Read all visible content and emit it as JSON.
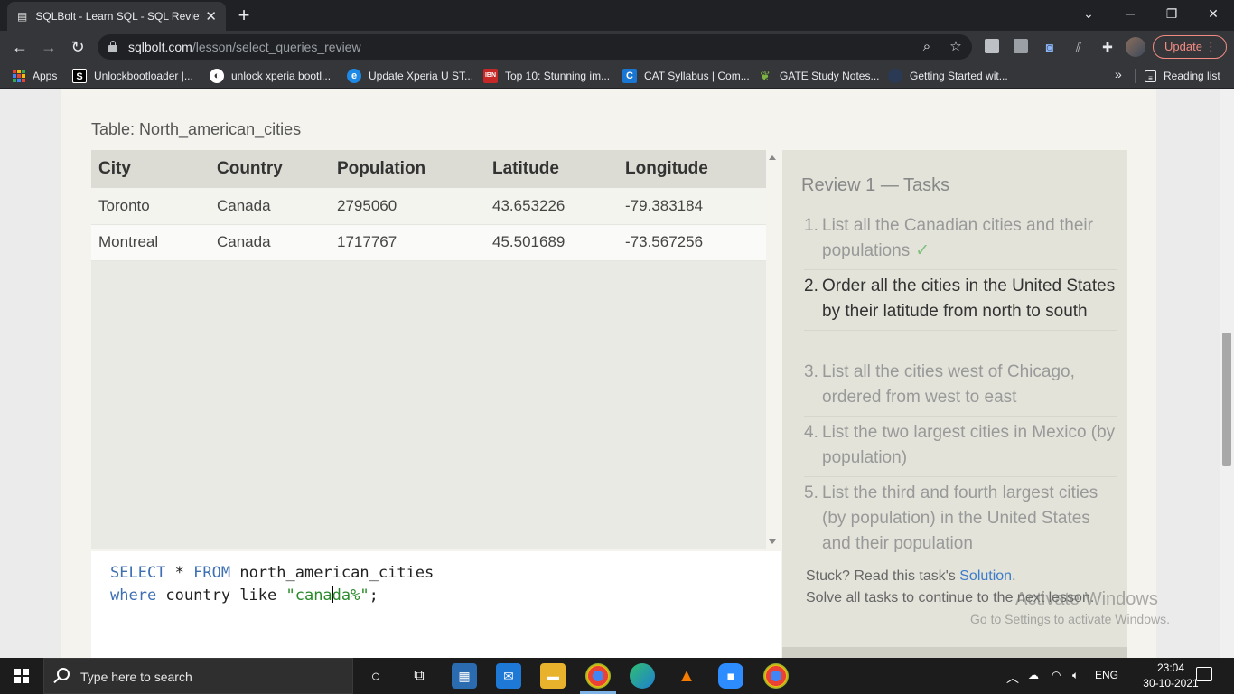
{
  "browser": {
    "tab_title": "SQLBolt - Learn SQL - SQL Review",
    "tab_close": "✕",
    "new_tab": "+",
    "url_host": "sqlbolt.com",
    "url_path": "/lesson/select_queries_review",
    "update_label": "Update",
    "update_more": "⋮"
  },
  "bookmarks": {
    "items": [
      {
        "label": "Apps",
        "icon": "apps-grid"
      },
      {
        "label": "Unlockbootloader |...",
        "icon": "S"
      },
      {
        "label": "unlock xperia bootl...",
        "icon": "globe"
      },
      {
        "label": "Update Xperia U ST...",
        "icon": "e"
      },
      {
        "label": "Top 10: Stunning im...",
        "icon": "IBN"
      },
      {
        "label": "CAT Syllabus | Com...",
        "icon": "C"
      },
      {
        "label": "GATE Study Notes...",
        "icon": "leaf"
      },
      {
        "label": "Getting Started wit...",
        "icon": "blank"
      }
    ],
    "overflow": "»",
    "reading_list": "Reading list"
  },
  "lesson": {
    "table_caption": "Table: North_american_cities",
    "columns": [
      "City",
      "Country",
      "Population",
      "Latitude",
      "Longitude"
    ],
    "rows": [
      [
        "Toronto",
        "Canada",
        "2795060",
        "43.653226",
        "-79.383184"
      ],
      [
        "Montreal",
        "Canada",
        "1717767",
        "45.501689",
        "-73.567256"
      ]
    ],
    "query": {
      "line1": {
        "kw1": "SELECT",
        "mid": " * ",
        "kw2": "FROM",
        "rest": " north_american_cities"
      },
      "line2": {
        "kw": "where",
        "mid": " country like ",
        "str_before_cursor": "\"cana",
        "str_after_cursor": "da%\"",
        "end": ";"
      }
    }
  },
  "tasks": {
    "title": "Review 1 — Tasks",
    "items": [
      {
        "num": "1.",
        "text": "List all the Canadian cities and their populations",
        "done_mark": "✓",
        "state": "done"
      },
      {
        "num": "2.",
        "text": "Order all the cities in the United States by their latitude from north to south",
        "state": "active"
      },
      {
        "num": "3.",
        "text": "List all the cities west of Chicago, ordered from west to east",
        "state": "pending"
      },
      {
        "num": "4.",
        "text": "List the two largest cities in Mexico (by population)",
        "state": "pending"
      },
      {
        "num": "5.",
        "text": "List the third and fourth largest cities (by population) in the United States and their population",
        "state": "pending"
      }
    ],
    "stuck_prefix": "Stuck? Read this task's ",
    "solution_link": "Solution",
    "stuck_suffix": ".",
    "continue_text": "Solve all tasks to continue to the next lesson."
  },
  "watermark": {
    "line1": "Activate Windows",
    "line2": "Go to Settings to activate Windows."
  },
  "taskbar": {
    "search_placeholder": "Type here to search",
    "language": "ENG",
    "time": "23:04",
    "date": "30-10-2021"
  }
}
